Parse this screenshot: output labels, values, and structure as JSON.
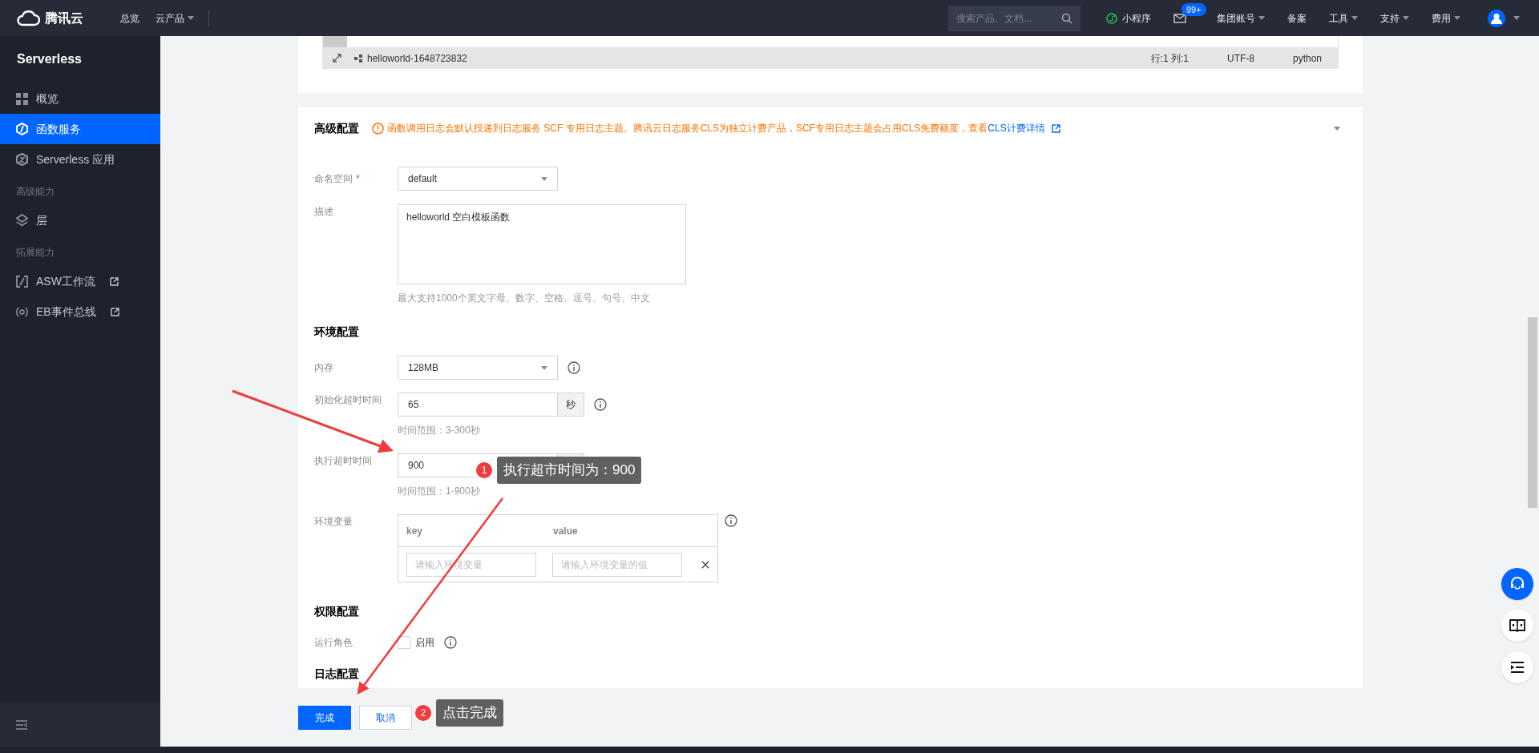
{
  "top_bar": {
    "logo": "腾讯云",
    "nav": [
      {
        "label": "总览",
        "dropdown": false
      },
      {
        "label": "云产品",
        "dropdown": true
      }
    ],
    "search": {
      "placeholder": "搜索产品、文档..."
    },
    "mini_program": "小程序",
    "mail_badge": "99+",
    "menus": [
      {
        "label": "集团账号",
        "dropdown": true
      },
      {
        "label": "备案",
        "dropdown": false
      },
      {
        "label": "工具",
        "dropdown": true
      },
      {
        "label": "支持",
        "dropdown": true
      },
      {
        "label": "费用",
        "dropdown": true
      }
    ]
  },
  "sidebar": {
    "title": "Serverless",
    "items": [
      {
        "kind": "item",
        "label": "概览",
        "selected": false,
        "external": false
      },
      {
        "kind": "item",
        "label": "函数服务",
        "selected": true,
        "external": false
      },
      {
        "kind": "item",
        "label": "Serverless 应用",
        "selected": false,
        "external": false
      },
      {
        "kind": "heading",
        "label": "高级能力"
      },
      {
        "kind": "item",
        "label": "层",
        "selected": false,
        "external": false
      },
      {
        "kind": "heading",
        "label": "拓展能力"
      },
      {
        "kind": "item",
        "label": "ASW工作流",
        "selected": false,
        "external": true
      },
      {
        "kind": "item",
        "label": "EB事件总线",
        "selected": false,
        "external": true
      }
    ]
  },
  "editor_status": {
    "file": "helloworld-1648723832",
    "position": "行:1 列:1",
    "encoding": "UTF-8",
    "language": "python"
  },
  "advanced": {
    "title": "高级配置",
    "notice": "函数调用日志会默认投递到日志服务 SCF 专用日志主题。腾讯云日志服务CLS为独立计费产品，SCF专用日志主题会占用CLS免费额度，查看",
    "notice_link": "CLS计费详情",
    "namespace": {
      "label": "命名空间",
      "required_mark": "*",
      "value": "default"
    },
    "description": {
      "label": "描述",
      "value": "helloworld 空白模板函数",
      "hint": "最大支持1000个英文字母、数字、空格、逗号、句号、中文"
    },
    "env_title": "环境配置",
    "memory": {
      "label": "内存",
      "value": "128MB"
    },
    "init_timeout": {
      "label": "初始化超时时间",
      "value": "65",
      "unit": "秒",
      "hint": "时间范围：3-300秒"
    },
    "exec_timeout": {
      "label": "执行超时时间",
      "value": "900",
      "hint": "时间范围：1-900秒"
    },
    "env_vars": {
      "label": "环境变量",
      "columns": [
        "key",
        "value"
      ],
      "key_placeholder": "请输入环境变量",
      "value_placeholder": "请输入环境变量的值"
    },
    "perm_title": "权限配置",
    "role": {
      "label": "运行角色",
      "checkbox_label": "启用",
      "checked": false
    },
    "log_title": "日志配置"
  },
  "actions": [
    {
      "label": "完成",
      "primary": true
    },
    {
      "label": "取消",
      "primary": false
    }
  ],
  "annotations": [
    {
      "number": "1",
      "text": "执行超市时间为：900"
    },
    {
      "number": "2",
      "text": "点击完成"
    }
  ]
}
